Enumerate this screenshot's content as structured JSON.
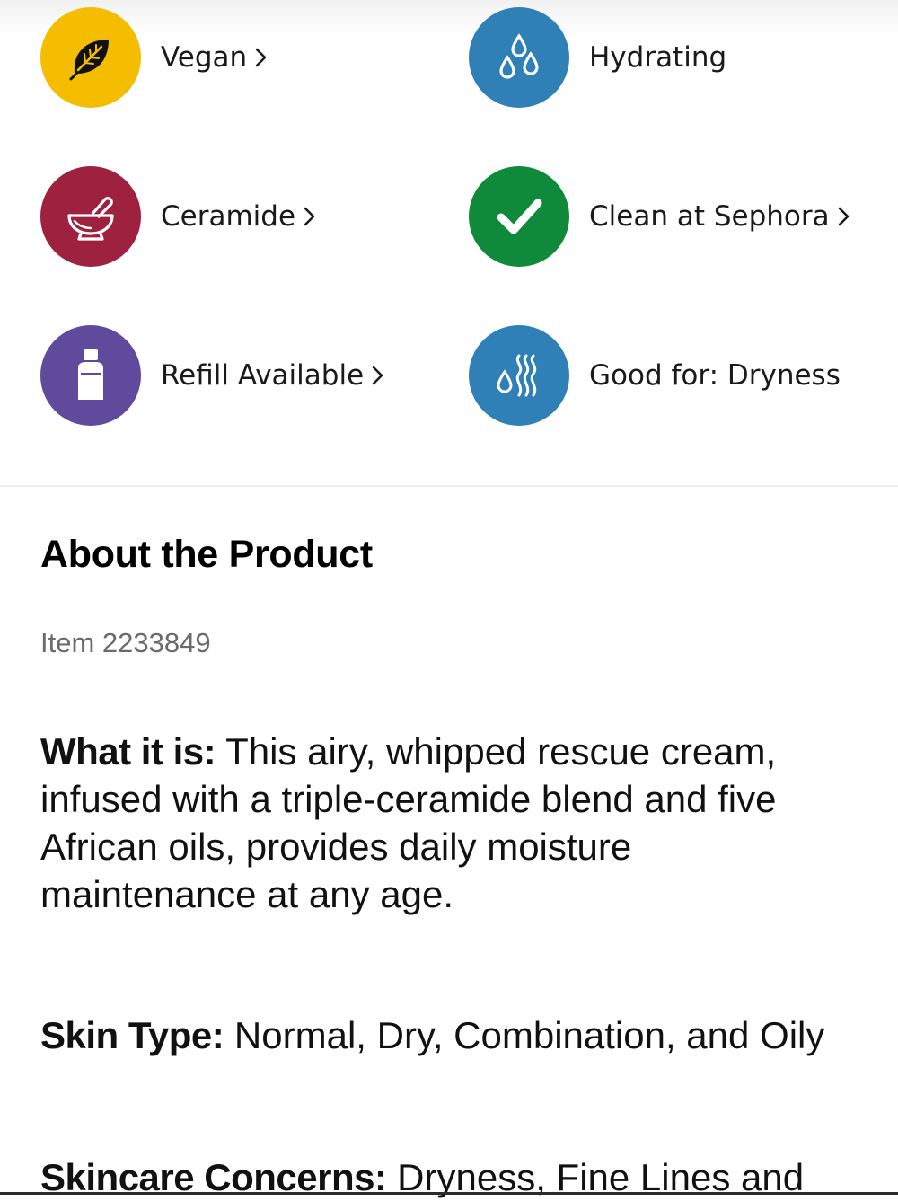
{
  "highlights": [
    {
      "label": "Vegan",
      "icon": "leaf-icon",
      "color": "#F5BD00",
      "has_chevron": true
    },
    {
      "label": "Hydrating",
      "icon": "water-drops-icon",
      "color": "#2F80B7",
      "has_chevron": false
    },
    {
      "label": "Ceramide",
      "icon": "mortar-bowl-icon",
      "color": "#9E2240",
      "has_chevron": true
    },
    {
      "label": "Clean at Sephora",
      "icon": "checkmark-icon",
      "color": "#0F8A3A",
      "has_chevron": true
    },
    {
      "label": "Refill Available",
      "icon": "refill-bottle-icon",
      "color": "#5F4A9C",
      "has_chevron": true
    },
    {
      "label": "Good for: Dryness",
      "icon": "dryness-waves-icon",
      "color": "#2F80B7",
      "has_chevron": false
    }
  ],
  "about": {
    "title": "About the Product",
    "item_number": "Item 2233849",
    "what_it_is": {
      "label": "What it is:",
      "text": " This airy, whipped rescue cream, infused with a triple-ceramide blend and five African oils, provides daily moisture maintenance at any age."
    },
    "skin_type": {
      "label": "Skin Type:",
      "text": " Normal, Dry, Combination, and Oily"
    },
    "skincare_concerns": {
      "label": "Skincare Concerns:",
      "text": " Dryness, Fine Lines and"
    }
  }
}
